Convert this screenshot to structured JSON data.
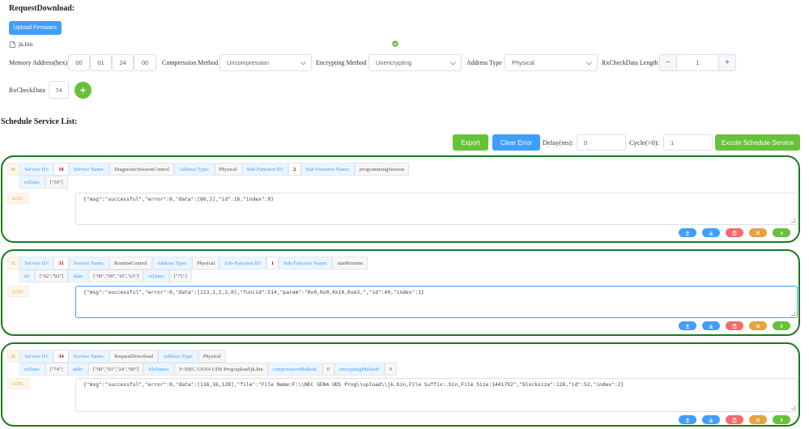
{
  "request_download": {
    "title": "RequestDownload:",
    "upload_label": "Upload Firmware",
    "file_name": "jk.bin",
    "memory_label": "Memory Address(hex)",
    "memory_bytes": [
      "00",
      "01",
      "24",
      "00"
    ],
    "compression_label": "Compression Method",
    "compression_value": "Uncompression",
    "encrypting_label": "Encrypting Method",
    "encrypting_value": "Unencrypting",
    "address_type_label": "Address Type",
    "address_type_value": "Physical",
    "rx_length_label": "RxCheckData Length",
    "rx_length_value": "1",
    "rx_check_label": "RxCheckData",
    "rx_check_value": "74"
  },
  "schedule": {
    "title": "Schedule Service List:",
    "export_label": "Export",
    "clear_label": "Clear Error",
    "delay_label": "Delay(ms):",
    "delay_value": "0",
    "cycle_label": "Cycle(>0):",
    "cycle_value": "1",
    "execute_label": "Excute Schedule Service"
  },
  "services": [
    {
      "index": "0:",
      "row1": [
        {
          "k": "Service ID:",
          "v": "10",
          "num": true
        },
        {
          "k": "Service Name:",
          "v": "DiagnosticSessionControl"
        },
        {
          "k": "Address Type:",
          "v": "Physical"
        },
        {
          "k": "Sub-Function ID:",
          "v": "2",
          "num": true
        },
        {
          "k": "Sub-Function Name:",
          "v": "programmingSession"
        }
      ],
      "row2": [
        {
          "k": "rxData:",
          "v": "[\"50\"]"
        }
      ],
      "log_label": "LOG:",
      "log": "{\"msg\":\"successful\",\"error\":0,\"data\":[80,2],\"id\":16,\"index\":0}"
    },
    {
      "index": "1:",
      "row1": [
        {
          "k": "Service ID:",
          "v": "31",
          "num": true
        },
        {
          "k": "Service Name:",
          "v": "RoutineControl"
        },
        {
          "k": "Address Type:",
          "v": "Physical"
        },
        {
          "k": "Sub-Function ID:",
          "v": "1",
          "num": true
        },
        {
          "k": "Sub-Function Name:",
          "v": "startRoutine"
        }
      ],
      "row2": [
        {
          "k": "id:",
          "v": "[\"02\",\"02\"]"
        },
        {
          "k": "data:",
          "v": "[\"00\",\"00\",\"10\",\"e3\"]"
        },
        {
          "k": "rxData:",
          "v": "[\"71\"]"
        }
      ],
      "log_label": "LOG:",
      "log": "{\"msg\":\"successful\",\"error\":0,\"data\":[113,1,2,2,0],\"funcid\":514,\"param\":\"0x0,0x0,0x10,0xe3,\",\"id\":49,\"index\":1}"
    },
    {
      "index": "2:",
      "row1": [
        {
          "k": "Service ID:",
          "v": "34",
          "num": true
        },
        {
          "k": "Service Name:",
          "v": "RequestDownload"
        },
        {
          "k": "Address Type:",
          "v": "Physical"
        }
      ],
      "row2": [
        {
          "k": "rxData:",
          "v": "[\"74\"]"
        },
        {
          "k": "addr:",
          "v": "[\"00\",\"01\",\"24\",\"00\"]"
        },
        {
          "k": "fileName:",
          "v": "F:\\NEC GEN4 UDS Prog\\upload\\jk.bin"
        },
        {
          "k": "compressionMethod:",
          "v": "0"
        },
        {
          "k": "encryptingMethod:",
          "v": "0"
        }
      ],
      "log_label": "LOG:",
      "log": "{\"msg\":\"successful\",\"error\":0,\"data\":[116,16,128],\"file\":\"File Name:F:\\\\NEC GEN4 UDS Prog\\\\upload\\\\jk.bin,File Suffix:.bin,File Size:1441792\",\"blocksize\":128,\"id\":52,\"index\":2}"
    }
  ],
  "icons": [
    "upload-icon",
    "download-icon",
    "delete-icon",
    "close-icon",
    "play-icon",
    "check-circle-icon",
    "file-icon",
    "plus-icon"
  ],
  "colors": {
    "primary": "#409eff",
    "success": "#67c23a",
    "danger": "#f56c6c",
    "warning": "#e6a23c",
    "card_border": "#1a7a1a"
  }
}
